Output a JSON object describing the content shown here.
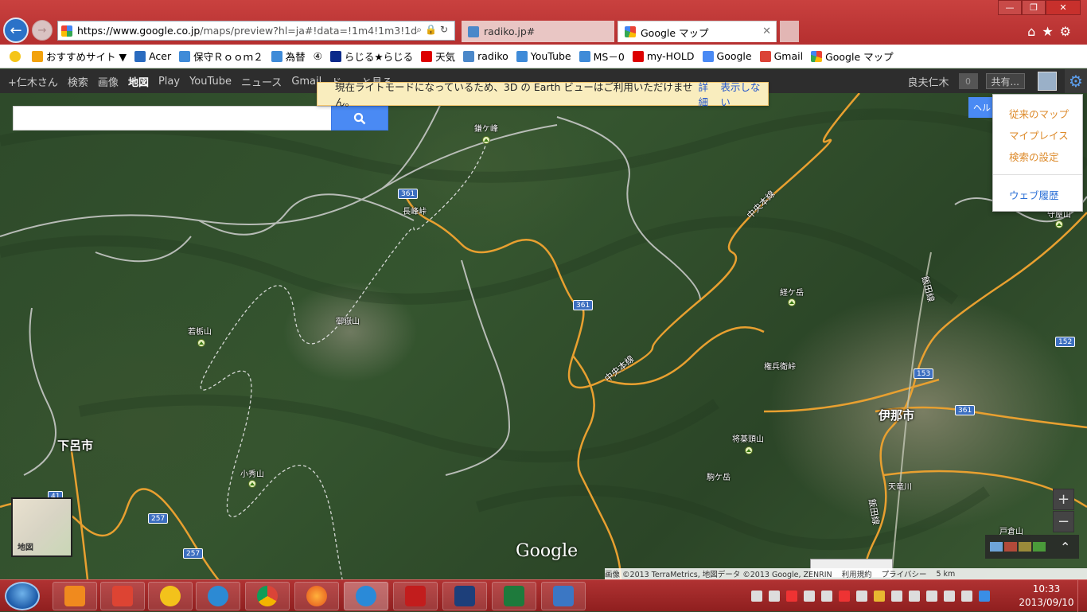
{
  "browser": {
    "url_host": "https://www.google.co.jp",
    "url_rest": "/maps/preview?hl=ja#!data=!1m4!1m3!1d",
    "tabs": [
      {
        "label": "radiko.jp#",
        "icon": "radiko-icon"
      },
      {
        "label": "Google マップ",
        "icon": "google-maps-icon"
      }
    ]
  },
  "favorites": [
    {
      "label": "おすすめサイト ▼",
      "icon": "recommended-sites-icon"
    },
    {
      "label": "Acer",
      "icon": "acer-icon"
    },
    {
      "label": "保守Ｒｏｏｍ２",
      "icon": "ie-page-icon"
    },
    {
      "label": "為替",
      "icon": "ie-page-icon"
    },
    {
      "label": "④",
      "icon": ""
    },
    {
      "label": "らじる★らじる",
      "icon": "nhk-icon"
    },
    {
      "label": "天気",
      "icon": "yahoo-icon"
    },
    {
      "label": "radiko",
      "icon": "radiko-icon"
    },
    {
      "label": "YouTube",
      "icon": "ie-page-icon"
    },
    {
      "label": "MS－0",
      "icon": "ie-page-icon"
    },
    {
      "label": "my-HOLD",
      "icon": "yahoo-icon"
    },
    {
      "label": "Google",
      "icon": "google-icon"
    },
    {
      "label": "Gmail",
      "icon": "gmail-icon"
    },
    {
      "label": "Google マップ",
      "icon": "google-maps-icon"
    }
  ],
  "gbar": {
    "items": [
      "+仁木さん",
      "検索",
      "画像",
      "地図",
      "Play",
      "YouTube",
      "ニュース",
      "Gmail",
      "ド…",
      "と見る"
    ],
    "active": "地図",
    "user_name": "良夫仁木",
    "notification_count": "0",
    "share_label": "共有..."
  },
  "banner": {
    "message": "現在ライトモードになっているため、3D の Earth ビューはご利用いただけません。",
    "details_link": "詳細",
    "dismiss_link": "表示しない"
  },
  "settings_menu": {
    "items": [
      "従来のマップ",
      "マイプレイス",
      "検索の設定"
    ],
    "history": "ウェブ履歴",
    "help_tab": "ヘル"
  },
  "map": {
    "cities": [
      "下呂市",
      "伊那市"
    ],
    "peaks": [
      "鎌ケ峰",
      "御嶽山",
      "若栃山",
      "経ケ岳",
      "将棊頭山",
      "駒ケ岳",
      "小秀山",
      "戸倉山"
    ],
    "places": [
      "長峰峠",
      "権兵衛峠",
      "天竜川",
      "中央本線",
      "中央本線",
      "飯田線",
      "飯田線",
      "守屋山"
    ],
    "route_shields": [
      "361",
      "361",
      "361",
      "153",
      "152",
      "257",
      "257",
      "41"
    ],
    "minimap_label": "地図",
    "watermark": "Google",
    "zoom_in": "+",
    "zoom_out": "−",
    "attribution": "画像 ©2013 TerraMetrics, 地図データ ©2013 Google, ZENRIN",
    "terms": "利用規約",
    "privacy": "プライバシー",
    "scale": "5 km"
  },
  "taskbar": {
    "time": "10:33",
    "date": "2013/09/10"
  },
  "colors": {
    "chrome_red": "#b52f2f",
    "search_blue": "#4a8af4",
    "banner_yellow": "#f9edbe",
    "menu_orange": "#dd8a2a",
    "road_orange": "#e8a030"
  }
}
